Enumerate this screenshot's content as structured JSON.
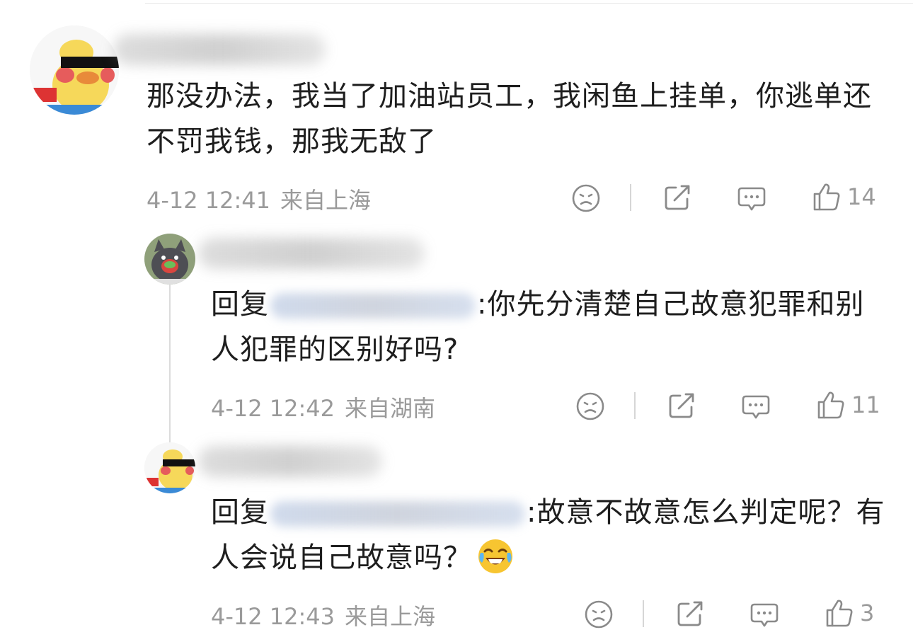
{
  "comments": [
    {
      "text": "那没办法，我当了加油站员工，我闲鱼上挂单，你逃单还不罚我钱，那我无敌了",
      "time": "4-12 12:41",
      "location": "来自上海",
      "likes": "14"
    },
    {
      "reply_prefix": "回复",
      "text": ":你先分清楚自己故意犯罪和别人犯罪的区别好吗?",
      "time": "4-12 12:42",
      "location": "来自湖南",
      "likes": "11"
    },
    {
      "reply_prefix": "回复",
      "text": ":故意不故意怎么判定呢？有人会说自己故意吗？",
      "time": "4-12 12:43",
      "location": "来自上海",
      "likes": "3"
    }
  ],
  "icons": {
    "dislike": "sad-face-icon",
    "share": "share-icon",
    "comment": "comment-bubble-icon",
    "like": "thumbs-up-icon",
    "emoji": "laugh-cry-emoji"
  },
  "colors": {
    "text": "#1e1e1e",
    "meta": "#9a9a9a",
    "icon": "#8a8a8a"
  }
}
